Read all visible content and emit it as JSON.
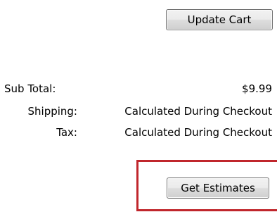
{
  "cart": {
    "update_cart_label": "Update Cart",
    "get_estimates_label": "Get Estimates"
  },
  "totals": {
    "subtotal_label": "Sub Total:",
    "subtotal_value": "$9.99",
    "shipping_label": "Shipping:",
    "shipping_value": "Calculated During Checkout",
    "tax_label": "Tax:",
    "tax_value": "Calculated During Checkout"
  },
  "colors": {
    "highlight": "#c0262c",
    "button_border": "#707070"
  }
}
